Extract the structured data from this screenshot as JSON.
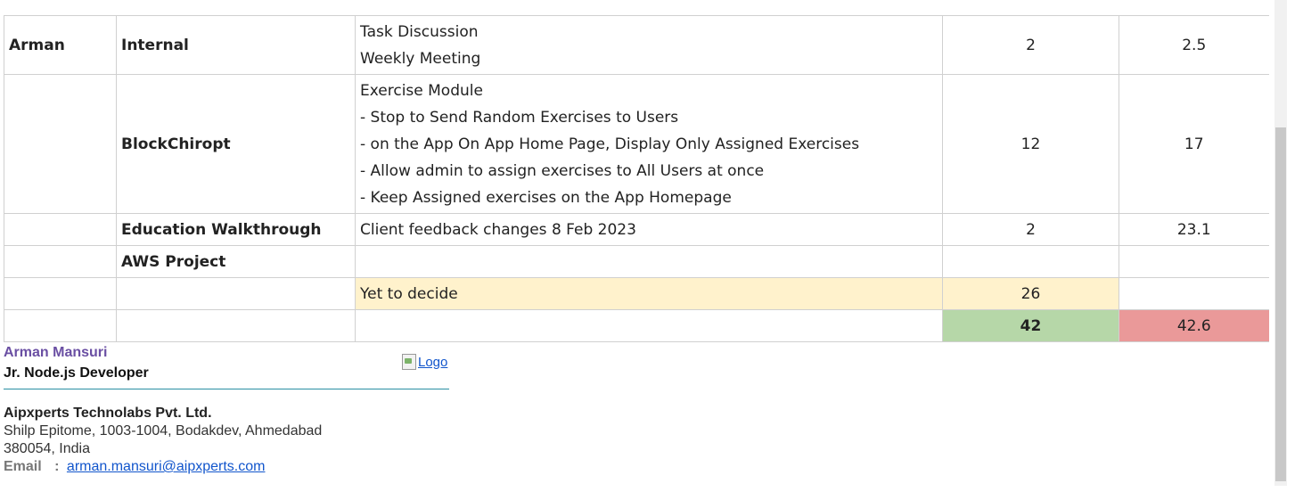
{
  "table": {
    "rows": [
      {
        "name": "Arman",
        "project": "Internal",
        "tasks": [
          "Task Discussion",
          "Weekly Meeting"
        ],
        "col4": "2",
        "col5": "2.5"
      },
      {
        "name": "",
        "project": "BlockChiropt",
        "tasks": [
          "Exercise Module",
          "- Stop to Send Random Exercises to Users",
          "- on the App On App Home Page, Display Only Assigned Exercises",
          "- Allow admin to assign exercises to All Users at once",
          "- Keep Assigned exercises on the App Homepage"
        ],
        "col4": "12",
        "col5": "17"
      },
      {
        "name": "",
        "project": "Education Walkthrough",
        "tasks": [
          "Client feedback changes 8 Feb 2023"
        ],
        "col4": "2",
        "col5": "23.1"
      },
      {
        "name": "",
        "project": "AWS Project",
        "tasks": [
          ""
        ],
        "col4": "",
        "col5": ""
      },
      {
        "name": "",
        "project": "",
        "tasks": [
          "Yet to decide"
        ],
        "col4": "26",
        "col5": ""
      },
      {
        "name": "",
        "project": "",
        "tasks": [
          ""
        ],
        "col4": "42",
        "col5": "42.6"
      }
    ],
    "colors": {
      "pending_highlight": "#fff2cc",
      "total_green": "#b6d7a8",
      "total_red": "#ea9999"
    }
  },
  "signature": {
    "name": "Arman Mansuri",
    "title": "Jr. Node.js Developer",
    "logo_alt": "Logo",
    "company": "Aipxperts Technolabs Pvt. Ltd.",
    "address_line1": "Shilp Epitome, 1003-1004, Bodakdev, Ahmedabad",
    "address_line2": "380054, India",
    "email_label": "Email",
    "email_separator": ":",
    "email": "arman.mansuri@aipxperts.com"
  }
}
